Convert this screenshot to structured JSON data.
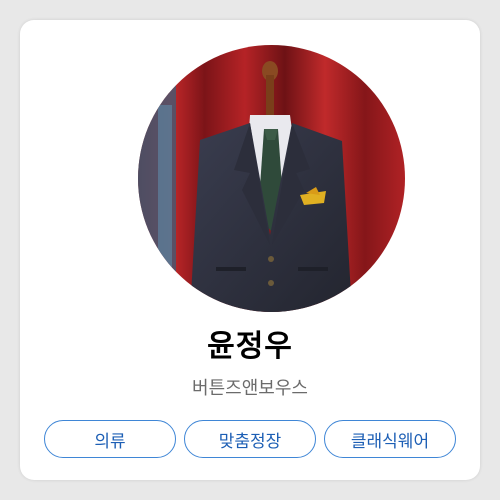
{
  "profile": {
    "name": "윤정우",
    "subtitle": "버튼즈앤보우스",
    "avatar_icon": "suit-on-mannequin-photo"
  },
  "tags": [
    "의류",
    "맞춤정장",
    "클래식웨어"
  ],
  "colors": {
    "card_bg": "#ffffff",
    "page_bg": "#e8e8e8",
    "tag_border": "#3f86d6",
    "tag_text": "#1d5fb5",
    "subtitle_text": "#6b6b6b"
  }
}
